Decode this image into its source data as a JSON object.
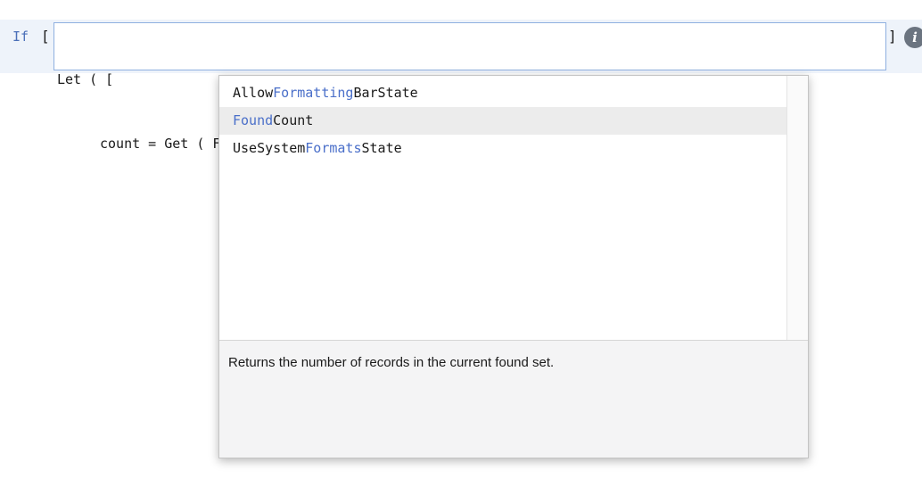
{
  "step": {
    "keyword": "If",
    "open_bracket": "[",
    "close_bracket": "]",
    "info_button_glyph": "i",
    "info_icon": "info-icon"
  },
  "calculation": {
    "line1": "Let ( [",
    "line2": "count = Get ( Fo"
  },
  "autocomplete": {
    "items": [
      {
        "segments": [
          {
            "text": "Allow",
            "match": false
          },
          {
            "text": "Formatting",
            "match": true
          },
          {
            "text": "BarState",
            "match": false
          }
        ]
      },
      {
        "segments": [
          {
            "text": "Found",
            "match": true
          },
          {
            "text": "Count",
            "match": false
          }
        ]
      },
      {
        "segments": [
          {
            "text": "UseSystem",
            "match": false
          },
          {
            "text": "Formats",
            "match": true
          },
          {
            "text": "State",
            "match": false
          }
        ]
      }
    ],
    "selected_index": 1,
    "description": "Returns the number of records in the current found set."
  },
  "colors": {
    "keyword": "#4a6fb8",
    "match_highlight": "#4a6fc9",
    "field_border": "#8fb0e0",
    "step_background": "#eef3fa",
    "selected_row": "#ececec"
  }
}
